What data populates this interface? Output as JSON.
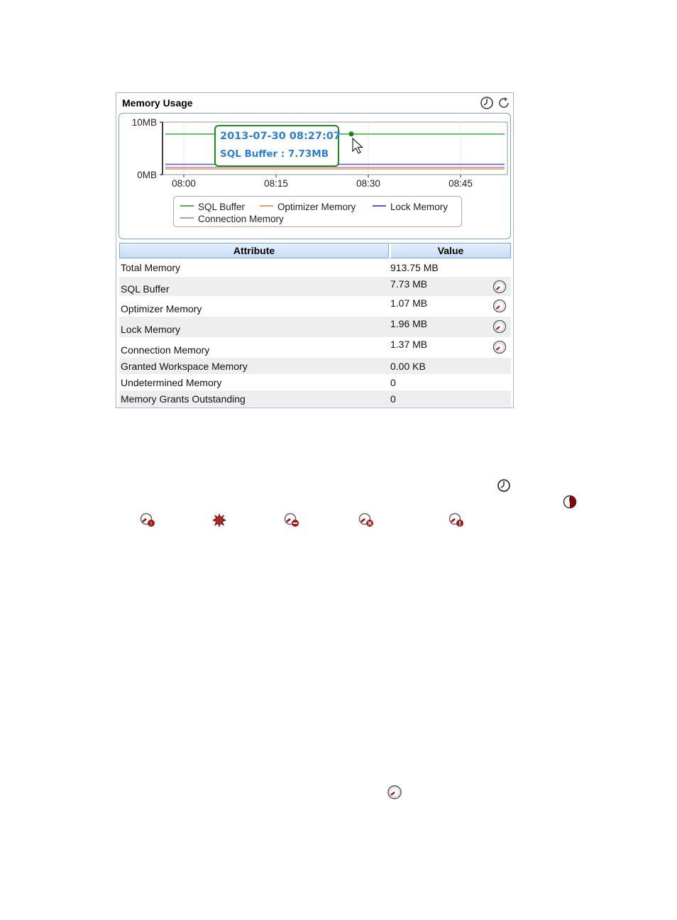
{
  "panel": {
    "title": "Memory Usage",
    "icons": [
      "clock-icon",
      "refresh-icon"
    ]
  },
  "chart_data": {
    "type": "line",
    "y_ticks": [
      "10MB",
      "0MB"
    ],
    "x_ticks": [
      "08:00",
      "08:15",
      "08:30",
      "08:45"
    ],
    "ylim": [
      0,
      10
    ],
    "y_unit": "MB",
    "grid": true,
    "series": [
      {
        "name": "SQL Buffer",
        "color": "#4caf50",
        "value": 7.73
      },
      {
        "name": "Optimizer Memory",
        "color": "#ff9a66",
        "value": 1.07
      },
      {
        "name": "Lock Memory",
        "color": "#5555ee",
        "value": 1.96
      },
      {
        "name": "Connection Memory",
        "color": "#b09ab8",
        "value": 1.37
      }
    ],
    "legend_position": "bottom"
  },
  "tooltip": {
    "time": "2013-07-30 08:27:07",
    "text": "SQL Buffer : 7.73MB",
    "border_color": "#1e8a1e",
    "text_color": "#2b7fd6"
  },
  "table": {
    "headers": [
      "Attribute",
      "Value"
    ],
    "rows": [
      {
        "attribute": "Total Memory",
        "value": "913.75 MB",
        "gauge": false
      },
      {
        "attribute": "SQL Buffer",
        "value": "7.73 MB",
        "gauge": true
      },
      {
        "attribute": "Optimizer Memory",
        "value": "1.07 MB",
        "gauge": true
      },
      {
        "attribute": "Lock Memory",
        "value": "1.96 MB",
        "gauge": true
      },
      {
        "attribute": "Connection Memory",
        "value": "1.37 MB",
        "gauge": true
      },
      {
        "attribute": "Granted Workspace Memory",
        "value": "0.00 KB",
        "gauge": false
      },
      {
        "attribute": "Undetermined Memory",
        "value": "0",
        "gauge": false
      },
      {
        "attribute": "Memory Grants Outstanding",
        "value": "0",
        "gauge": false
      }
    ]
  },
  "inline_icons": [
    "clock-icon",
    "half-red-clock-icon",
    "gauge-1-icon",
    "red-burst-icon",
    "gauge-2-icon",
    "gauge-3-icon",
    "gauge-4-icon",
    "gauge-icon"
  ]
}
